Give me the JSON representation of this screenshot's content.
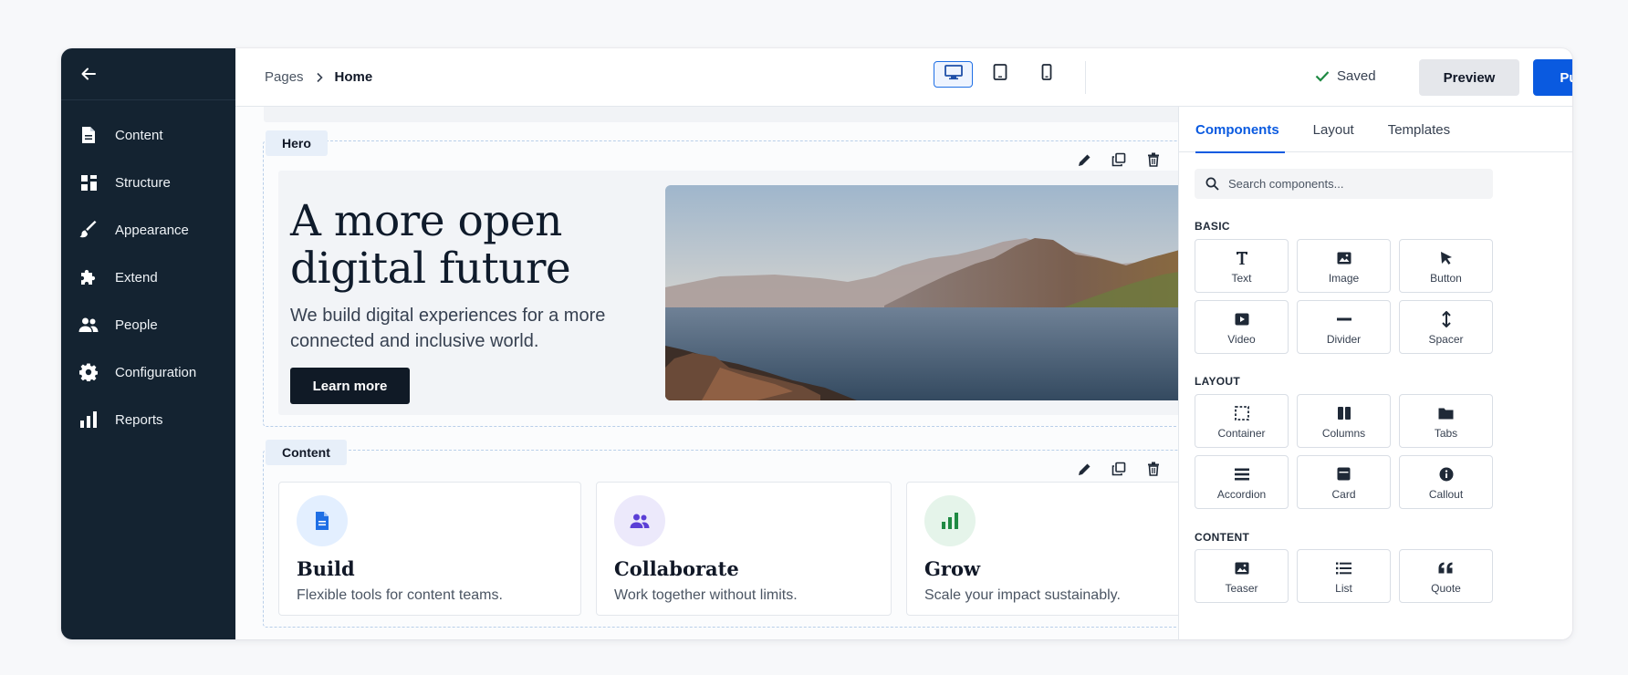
{
  "sidebar": {
    "items": [
      {
        "label": "Content",
        "icon": "document-icon"
      },
      {
        "label": "Structure",
        "icon": "grid-icon"
      },
      {
        "label": "Appearance",
        "icon": "brush-icon"
      },
      {
        "label": "Extend",
        "icon": "puzzle-icon"
      },
      {
        "label": "People",
        "icon": "people-icon"
      },
      {
        "label": "Configuration",
        "icon": "gear-icon"
      },
      {
        "label": "Reports",
        "icon": "bar-chart-icon"
      }
    ]
  },
  "header": {
    "breadcrumb": {
      "parent": "Pages",
      "current": "Home"
    },
    "saved_label": "Saved",
    "preview_label": "Preview",
    "publish_label": "Publish"
  },
  "hero": {
    "tag": "Hero",
    "title": "A more open digital future",
    "subtitle": "We build digital experiences for a more connected and inclusive world.",
    "cta": "Learn more"
  },
  "content_section": {
    "tag": "Content",
    "cards": [
      {
        "title": "Build",
        "desc": "Flexible tools for content teams.",
        "icon": "document-icon",
        "icon_bg": "#e3efff",
        "icon_color": "#1f6fe5"
      },
      {
        "title": "Collaborate",
        "desc": "Work together without limits.",
        "icon": "people-icon",
        "icon_bg": "#ece9fb",
        "icon_color": "#5b3fd6"
      },
      {
        "title": "Grow",
        "desc": "Scale your impact sustainably.",
        "icon": "bar-chart-icon",
        "icon_bg": "#e5f4ea",
        "icon_color": "#1f8a43"
      }
    ]
  },
  "panel": {
    "tabs": [
      "Components",
      "Layout",
      "Templates"
    ],
    "search_placeholder": "Search components...",
    "groups": [
      {
        "title": "BASIC",
        "items": [
          {
            "label": "Text",
            "icon": "text-icon"
          },
          {
            "label": "Image",
            "icon": "image-icon"
          },
          {
            "label": "Button",
            "icon": "cursor-icon"
          },
          {
            "label": "Video",
            "icon": "video-icon"
          },
          {
            "label": "Divider",
            "icon": "divider-icon"
          },
          {
            "label": "Spacer",
            "icon": "spacer-icon"
          }
        ]
      },
      {
        "title": "LAYOUT",
        "items": [
          {
            "label": "Container",
            "icon": "container-icon"
          },
          {
            "label": "Columns",
            "icon": "columns-icon"
          },
          {
            "label": "Tabs",
            "icon": "folder-icon"
          },
          {
            "label": "Accordion",
            "icon": "accordion-icon"
          },
          {
            "label": "Card",
            "icon": "card-icon"
          },
          {
            "label": "Callout",
            "icon": "info-icon"
          }
        ]
      },
      {
        "title": "CONTENT",
        "items": [
          {
            "label": "Teaser",
            "icon": "image-icon"
          },
          {
            "label": "List",
            "icon": "list-icon"
          },
          {
            "label": "Quote",
            "icon": "quote-icon"
          }
        ]
      }
    ]
  },
  "colors": {
    "sidebar_bg": "#142331",
    "accent": "#0a5ae0",
    "saved_check": "#1f8a43"
  }
}
